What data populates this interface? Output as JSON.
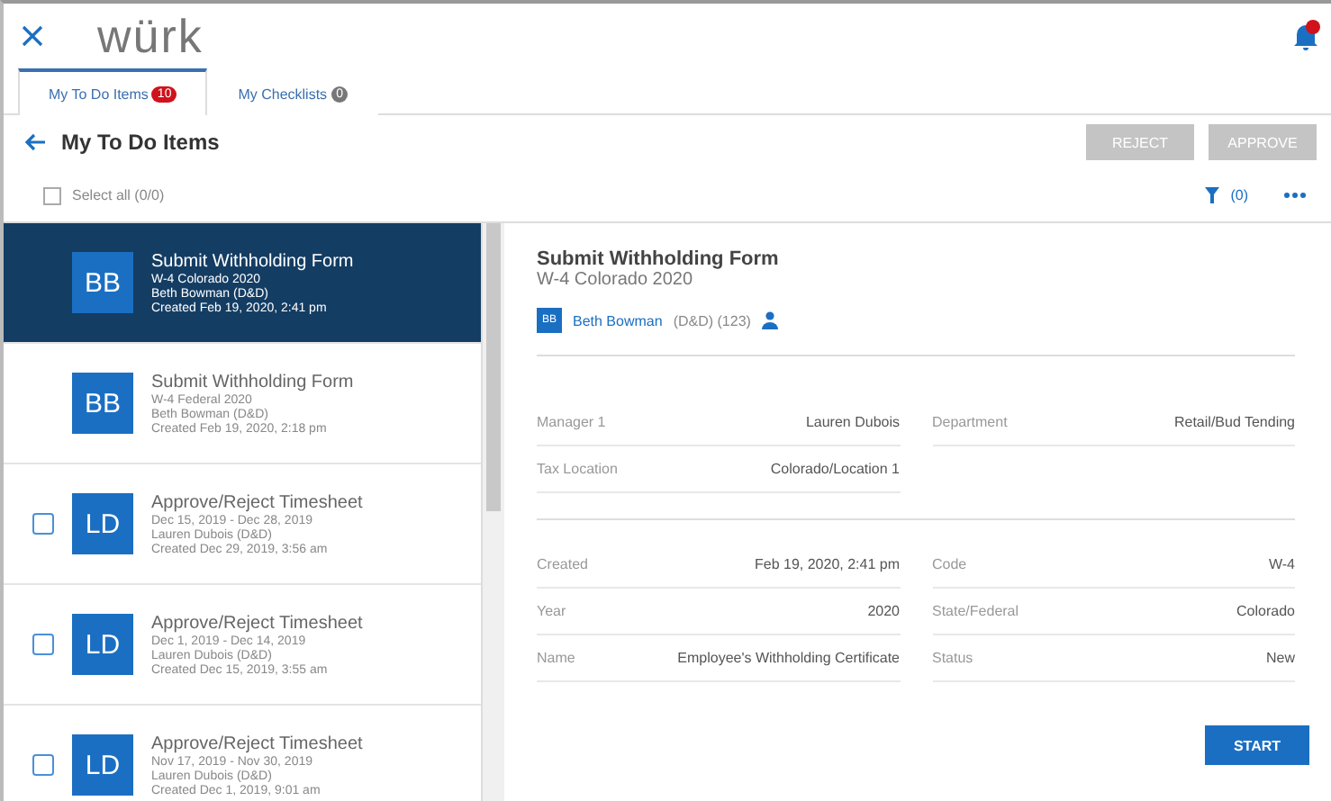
{
  "header": {
    "logo": "würk"
  },
  "tabs": [
    {
      "label": "My To Do Items",
      "count": "10",
      "selected": true
    },
    {
      "label": "My Checklists",
      "count": "0",
      "selected": false
    }
  ],
  "page_title": "My To Do Items",
  "buttons": [
    {
      "label": "REJECT",
      "disabled": true
    },
    {
      "label": "APPROVE",
      "disabled": true
    }
  ],
  "select_all": {
    "label": "Select all (0/0)",
    "checked": false
  },
  "filter": {
    "count": "(0)"
  },
  "items": [
    {
      "kind": "form",
      "initials": "BB",
      "title": "Submit Withholding Form",
      "line1": "W-4 Colorado 2020",
      "line2": "Beth Bowman (D&D)",
      "line3": "Created Feb 19, 2020, 2:41 pm",
      "selected": true
    },
    {
      "kind": "form",
      "initials": "BB",
      "title": "Submit Withholding Form",
      "line1": "W-4 Federal 2020",
      "line2": "Beth Bowman (D&D)",
      "line3": "Created Feb 19, 2020, 2:18 pm",
      "selected": false
    },
    {
      "kind": "timesheet",
      "checked": false,
      "initials": "LD",
      "title": "Approve/Reject Timesheet",
      "line1": "Dec 15, 2019 - Dec 28, 2019",
      "line2": "Lauren Dubois (D&D)",
      "line3": "Created Dec 29, 2019, 3:56 am",
      "selected": false
    },
    {
      "kind": "timesheet",
      "checked": false,
      "initials": "LD",
      "title": "Approve/Reject Timesheet",
      "line1": "Dec 1, 2019 - Dec 14, 2019",
      "line2": "Lauren Dubois (D&D)",
      "line3": "Created Dec 15, 2019, 3:55 am",
      "selected": false
    },
    {
      "kind": "timesheet",
      "checked": false,
      "initials": "LD",
      "title": "Approve/Reject Timesheet",
      "line1": "Nov 17, 2019 - Nov 30, 2019",
      "line2": "Lauren Dubois (D&D)",
      "line3": "Created Dec 1, 2019, 9:01 am",
      "selected": false
    }
  ],
  "detail": {
    "title": "Submit Withholding Form",
    "subtitle": "W-4 Colorado 2020",
    "avatar": "BB",
    "person": "Beth Bowman",
    "person_ids": "(D&D) (123)",
    "groups": [
      {
        "left": [
          {
            "label": "Manager 1",
            "value": "Lauren Dubois"
          },
          {
            "label": "Tax Location",
            "value": "Colorado/Location 1"
          }
        ],
        "right": [
          {
            "label": "Department",
            "value": "Retail/Bud Tending"
          }
        ]
      },
      {
        "left": [
          {
            "label": "Created",
            "value": "Feb 19, 2020, 2:41 pm"
          },
          {
            "label": "Year",
            "value": "2020"
          },
          {
            "label": "Name",
            "value": "Employee's Withholding Certificate"
          }
        ],
        "right": [
          {
            "label": "Code",
            "value": "W-4"
          },
          {
            "label": "State/Federal",
            "value": "Colorado"
          },
          {
            "label": "Status",
            "value": "New"
          }
        ]
      }
    ],
    "action": "START"
  }
}
